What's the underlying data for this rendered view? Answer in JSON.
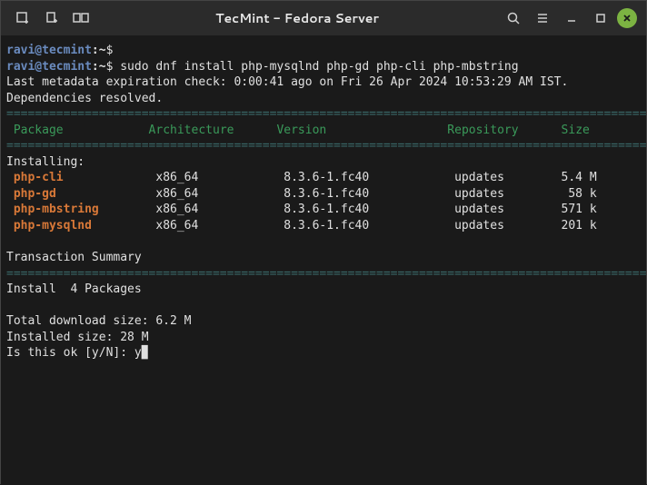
{
  "window": {
    "title": "TecMint - Fedora Server"
  },
  "term": {
    "prompt_user": "ravi@tecmint",
    "prompt_path": ":~",
    "prompt_sym": "$",
    "command": "sudo dnf install php-mysqlnd php-gd php-cli php-mbstring",
    "meta_line": "Last metadata expiration check: 0:00:41 ago on Fri 26 Apr 2024 10:53:29 AM IST.",
    "deps_line": "Dependencies resolved.",
    "hdr_package": " Package",
    "hdr_arch": "Architecture",
    "hdr_version": "Version",
    "hdr_repo": "Repository",
    "hdr_size": "Size",
    "installing_label": "Installing:",
    "packages": [
      {
        "name": "php-cli",
        "arch": "x86_64",
        "version": "8.3.6-1.fc40",
        "repo": "updates",
        "size": "5.4 M"
      },
      {
        "name": "php-gd",
        "arch": "x86_64",
        "version": "8.3.6-1.fc40",
        "repo": "updates",
        "size": " 58 k"
      },
      {
        "name": "php-mbstring",
        "arch": "x86_64",
        "version": "8.3.6-1.fc40",
        "repo": "updates",
        "size": "571 k"
      },
      {
        "name": "php-mysqlnd",
        "arch": "x86_64",
        "version": "8.3.6-1.fc40",
        "repo": "updates",
        "size": "201 k"
      }
    ],
    "trans_summary": "Transaction Summary",
    "install_count": "Install  4 Packages",
    "dl_size": "Total download size: 6.2 M",
    "inst_size": "Installed size: 28 M",
    "confirm_prompt": "Is this ok [y/N]: ",
    "confirm_answer": "y",
    "divider_long": "==========================================================================================",
    "cursor": "▉"
  }
}
